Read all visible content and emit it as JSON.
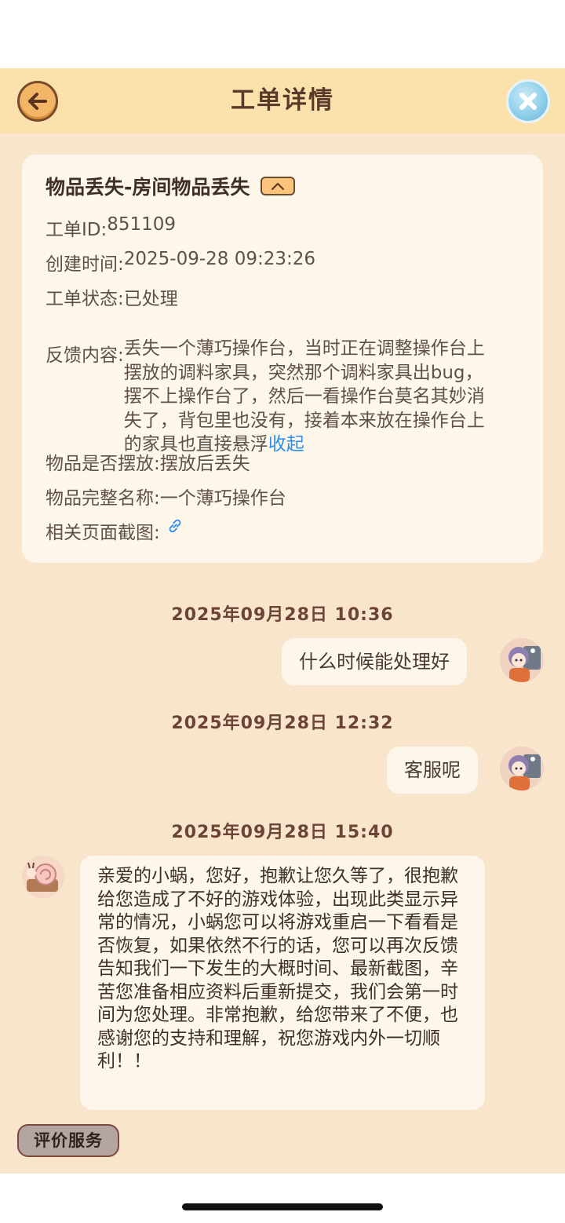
{
  "header": {
    "title": "工单详情",
    "back_icon": "arrow-left-icon",
    "close_icon": "close-icon"
  },
  "ticket": {
    "title": "物品丢失-房间物品丢失",
    "id_label": "工单ID: ",
    "id_value": "851109",
    "created_label": "创建时间: ",
    "created_value": "2025-09-28 09:23:26",
    "status_label": "工单状态: ",
    "status_value": "已处理",
    "feedback_label": "反馈内容: ",
    "feedback_value": "丢失一个薄巧操作台，当时正在调整操作台上摆放的调料家具，突然那个调料家具出bug，摆不上操作台了，然后一看操作台莫名其妙消失了，背包里也没有，接着本来放在操作台上的家具也直接悬浮",
    "collapse_label": "收起",
    "placed_label": "物品是否摆放: ",
    "placed_value": "摆放后丢失",
    "fullname_label": "物品完整名称: ",
    "fullname_value": "一个薄巧操作台",
    "screenshot_label": "相关页面截图: ",
    "screenshot_icon": "link-icon"
  },
  "messages": [
    {
      "time": "2025年09月28日 10:36",
      "sender": "user",
      "text": "什么时候能处理好"
    },
    {
      "time": "2025年09月28日 12:32",
      "sender": "user",
      "text": "客服呢"
    },
    {
      "time": "2025年09月28日 15:40",
      "sender": "support",
      "text": "亲爱的小蜗，您好，抱歉让您久等了，很抱歉给您造成了不好的游戏体验，出现此类显示异常的情况，小蜗您可以将游戏重启一下看看是否恢复，如果依然不行的话，您可以再次反馈告知我们一下发生的大概时间、最新截图，辛苦您准备相应资料后重新提交，我们会第一时间为您处理。非常抱歉，给您带来了不便，也感谢您的支持和理解，祝您游戏内外一切顺利！！"
    }
  ],
  "rate_button": "评价服务",
  "colors": {
    "header_bg": "#fbe2ac",
    "page_bg": "#f9e4cc",
    "card_bg": "#fdf6ea",
    "link": "#2e8ff0"
  }
}
